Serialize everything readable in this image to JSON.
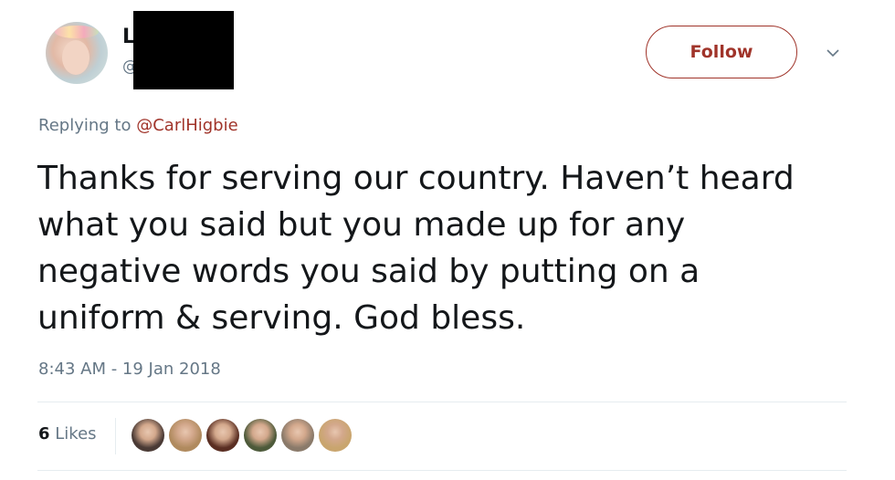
{
  "author": {
    "name_visible": "L",
    "handle_visible": "@"
  },
  "follow_label": "Follow",
  "reply_context": {
    "prefix": "Replying to",
    "mention": "@CarlHigbie"
  },
  "tweet_lines": [
    "Thanks for serving our country. Haven’t heard",
    "what you said but you made up for any",
    "negative words you said by putting on a",
    "uniform & serving. God bless."
  ],
  "timestamp": "8:43 AM - 19 Jan 2018",
  "likes": {
    "count": "6",
    "label": "Likes"
  },
  "likers": [
    {
      "name": "liker-1",
      "color": "#4a3a35"
    },
    {
      "name": "liker-2",
      "color": "#b08a5e"
    },
    {
      "name": "liker-3",
      "color": "#5a2e22"
    },
    {
      "name": "liker-4",
      "color": "#4d5a3a"
    },
    {
      "name": "liker-5",
      "color": "#8a7a6a"
    },
    {
      "name": "liker-6",
      "color": "#c9a56e"
    }
  ],
  "colors": {
    "accent": "#a0342a",
    "secondary_text": "#657786",
    "divider": "#e6ecf0"
  },
  "icons": {
    "dropdown": "chevron-down-icon"
  }
}
